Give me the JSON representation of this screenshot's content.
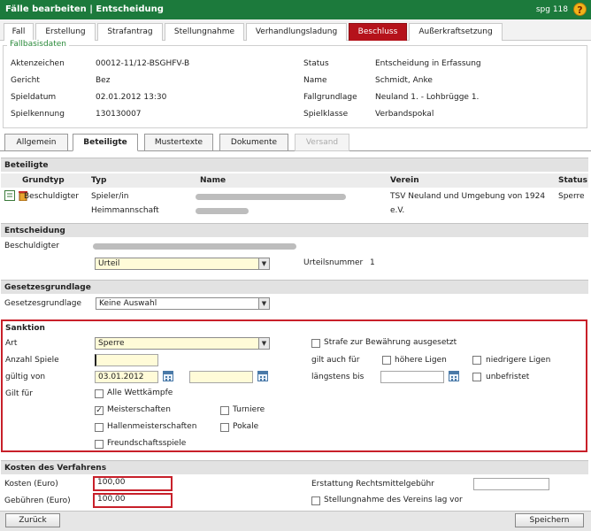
{
  "header": {
    "title": "Fälle bearbeiten | Entscheidung",
    "user": "spg 118",
    "help": "?"
  },
  "tabs": [
    "Fall",
    "Erstellung",
    "Strafantrag",
    "Stellungnahme",
    "Verhandlungsladung",
    "Beschluss",
    "Außerkraftsetzung"
  ],
  "fallbasisdaten": {
    "legend": "Fallbasisdaten",
    "aktenzeichen_label": "Aktenzeichen",
    "aktenzeichen": "00012-11/12-BSGHFV-B",
    "gericht_label": "Gericht",
    "gericht": "Bez",
    "spieldatum_label": "Spieldatum",
    "spieldatum": "02.01.2012 13:30",
    "spielkennung_label": "Spielkennung",
    "spielkennung": "130130007",
    "status_label": "Status",
    "status": "Entscheidung in Erfassung",
    "name_label": "Name",
    "name": "Schmidt, Anke",
    "fallgrundlage_label": "Fallgrundlage",
    "fallgrundlage": "Neuland 1. - Lohbrügge 1.",
    "spielklasse_label": "Spielklasse",
    "spielklasse": "Verbandspokal"
  },
  "subtabs": [
    "Allgemein",
    "Beteiligte",
    "Mustertexte",
    "Dokumente",
    "Versand"
  ],
  "beteiligte": {
    "heading": "Beteiligte",
    "columns": [
      "Grundtyp",
      "Typ",
      "Name",
      "Verein",
      "Status"
    ],
    "row": {
      "grundtyp": "Beschuldigter",
      "typ_line1": "Spieler/in",
      "typ_line2": "Heimmannschaft",
      "verein_line1": "TSV Neuland und Umgebung von 1924",
      "verein_line2": "e.V.",
      "status": "Sperre"
    }
  },
  "entscheidung": {
    "heading": "Entscheidung",
    "beschuldigter_label": "Beschuldigter",
    "art": "Urteil",
    "urteilsnummer_label": "Urteilsnummer",
    "urteilsnummer": "1"
  },
  "gesetzesgrundlage": {
    "heading": "Gesetzesgrundlage",
    "label": "Gesetzesgrundlage",
    "value": "Keine Auswahl"
  },
  "sanktion": {
    "heading": "Sanktion",
    "art_label": "Art",
    "art": "Sperre",
    "anzahl_label": "Anzahl Spiele",
    "anzahl": "",
    "gueltig_label": "gültig von",
    "gueltig_von": "03.01.2012",
    "gueltig_bis": "",
    "gilt_fuer_label": "Gilt für",
    "alle": "Alle Wettkämpfe",
    "meisterschaften": "Meisterschaften",
    "hallenmeisterschaften": "Hallenmeisterschaften",
    "freundschaftsspiele": "Freundschaftsspiele",
    "turniere": "Turniere",
    "pokale": "Pokale",
    "bewaehrung": "Strafe zur Bewährung ausgesetzt",
    "gilt_auch_label": "gilt auch für",
    "hoehere": "höhere Ligen",
    "niedrigere": "niedrigere Ligen",
    "laengstens_label": "längstens bis",
    "laengstens": "",
    "unbefristet": "unbefristet",
    "checked_meisterschaften": "✓"
  },
  "kosten": {
    "heading": "Kosten des Verfahrens",
    "kosten_label": "Kosten (Euro)",
    "kosten": "100,00",
    "gebuehren_label": "Gebühren (Euro)",
    "gebuehren": "100,00",
    "erstattung_label": "Erstattung Rechtsmittelgebühr",
    "erstattung": "",
    "stellungnahme": "Stellungnahme des Vereins lag vor"
  },
  "buttons": {
    "back": "Zurück",
    "save": "Speichern"
  },
  "colors": {
    "header_green": "#1c7a3c",
    "active_tab_red": "#b5121b",
    "highlight_red": "#c8202a"
  }
}
